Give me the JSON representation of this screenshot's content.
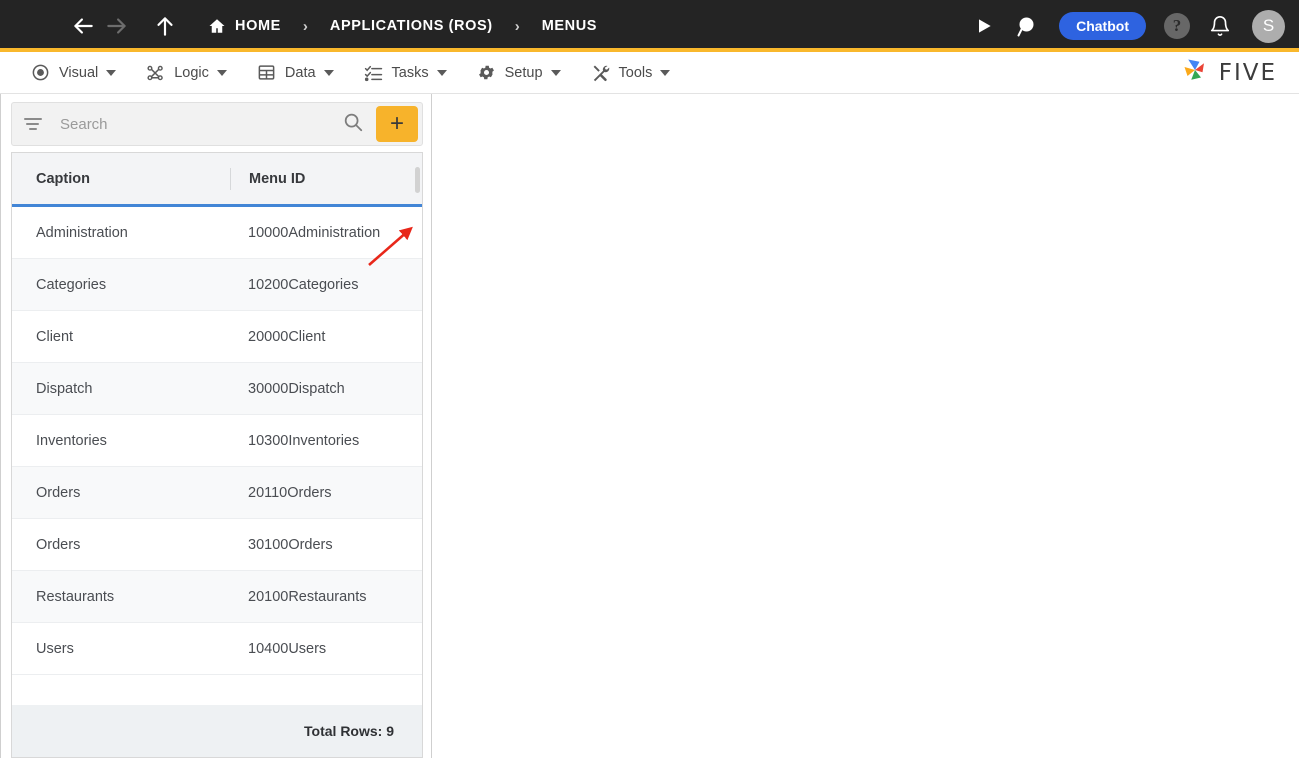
{
  "topbar": {
    "menu_icon": "hamburger-icon",
    "back_icon": "arrow-left-icon",
    "forward_icon": "arrow-right-icon",
    "up_icon": "arrow-up-icon",
    "breadcrumbs": [
      {
        "label": "HOME",
        "icon": "home-icon"
      },
      {
        "label": "APPLICATIONS (ROS)",
        "icon": ""
      },
      {
        "label": "MENUS",
        "icon": ""
      }
    ],
    "separator": "›",
    "run_icon": "play-icon",
    "chat_search_icon": "chat-search-icon",
    "chatbot_label": "Chatbot",
    "help_label": "?",
    "bell_icon": "bell-icon",
    "avatar_initial": "S",
    "bg_color": "#242424",
    "accent_bar_color": "#F9B82C",
    "chatbot_color": "#2E63E0"
  },
  "menubar": {
    "items": [
      {
        "label": "Visual",
        "icon": "eye-icon"
      },
      {
        "label": "Logic",
        "icon": "nodes-icon"
      },
      {
        "label": "Data",
        "icon": "table-icon"
      },
      {
        "label": "Tasks",
        "icon": "checklist-icon"
      },
      {
        "label": "Setup",
        "icon": "gear-icon"
      },
      {
        "label": "Tools",
        "icon": "tools-icon"
      }
    ],
    "brand": {
      "text": "FIVE",
      "icon": "five-pinwheel-logo"
    }
  },
  "search": {
    "placeholder": "Search",
    "value": "",
    "filter_icon": "filter-icon",
    "search_icon": "magnifier-icon",
    "add_label": "+",
    "add_color": "#F7B32B"
  },
  "grid": {
    "columns": [
      "Caption",
      "Menu ID"
    ],
    "header_underline_color": "#4285d6",
    "rows": [
      {
        "caption": "Administration",
        "menu_id": "10000Administration"
      },
      {
        "caption": "Categories",
        "menu_id": "10200Categories"
      },
      {
        "caption": "Client",
        "menu_id": "20000Client"
      },
      {
        "caption": "Dispatch",
        "menu_id": "30000Dispatch"
      },
      {
        "caption": "Inventories",
        "menu_id": "10300Inventories"
      },
      {
        "caption": "Orders",
        "menu_id": "20110Orders"
      },
      {
        "caption": "Orders",
        "menu_id": "30100Orders"
      },
      {
        "caption": "Restaurants",
        "menu_id": "20100Restaurants"
      },
      {
        "caption": "Users",
        "menu_id": "10400Users"
      }
    ],
    "footer": "Total Rows: 9"
  },
  "annotation": {
    "arrow_color": "#e8271a",
    "points_to": "add-record-button"
  }
}
